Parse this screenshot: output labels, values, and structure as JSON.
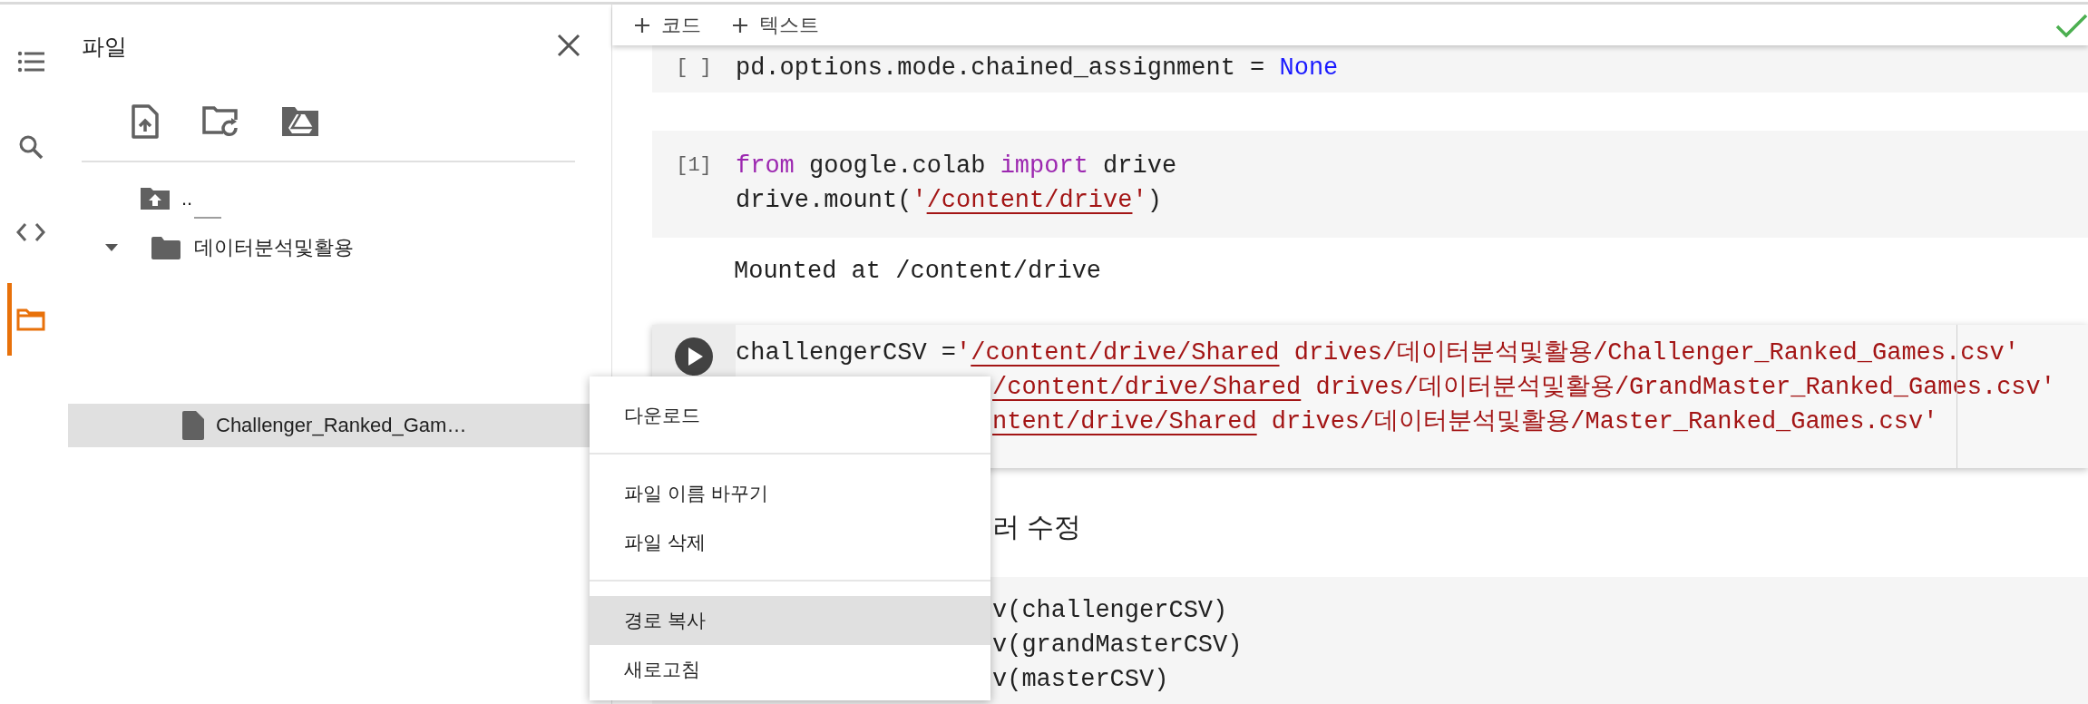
{
  "sidebar": {
    "items": [
      {
        "kind": "toc",
        "selected": false
      },
      {
        "kind": "search",
        "selected": false
      },
      {
        "kind": "code",
        "selected": false
      },
      {
        "kind": "files",
        "selected": true
      }
    ]
  },
  "files_panel": {
    "title": "파일",
    "tree": [
      {
        "kind": "parent",
        "label": "..",
        "selected": false
      },
      {
        "kind": "folder",
        "label": "데이터분석및활용",
        "expanded": true,
        "selected": false,
        "children": [
          {
            "kind": "file",
            "label": "Challenger_Ranked_Gam…",
            "selected": true
          }
        ]
      }
    ]
  },
  "toolbar": {
    "buttons": [
      {
        "label": "코드"
      },
      {
        "label": "텍스트"
      }
    ]
  },
  "cells": [
    {
      "kind": "code",
      "prompt": "[ ]",
      "focused": false,
      "lines": [
        {
          "covered": false,
          "tokens": [
            {
              "kind": "plain",
              "text": "pd.options.mode.chained_assignment = "
            },
            {
              "kind": "const",
              "text": "None"
            }
          ]
        }
      ]
    },
    {
      "kind": "code",
      "prompt": "[1]",
      "focused": false,
      "lines": [
        {
          "covered": false,
          "tokens": [
            {
              "kind": "kw",
              "text": "from"
            },
            {
              "kind": "plain",
              "text": " google.colab "
            },
            {
              "kind": "kw",
              "text": "import"
            },
            {
              "kind": "plain",
              "text": " drive"
            }
          ]
        },
        {
          "covered": false,
          "tokens": [
            {
              "kind": "plain",
              "text": "drive.mount("
            },
            {
              "kind": "str",
              "text": "'"
            },
            {
              "kind": "path",
              "text": "/content/drive"
            },
            {
              "kind": "str",
              "text": "'"
            },
            {
              "kind": "plain",
              "text": ")"
            }
          ]
        }
      ],
      "output": "Mounted at /content/drive"
    },
    {
      "kind": "code",
      "focused": true,
      "lines": [
        {
          "covered": false,
          "tokens": [
            {
              "kind": "plain",
              "text": "challengerCSV ="
            },
            {
              "kind": "str",
              "text": "'"
            },
            {
              "kind": "path",
              "text": "/content/drive/Shared"
            },
            {
              "kind": "str",
              "text": " drives/데이터분석및활용/Challenger_Ranked_Games.csv'"
            }
          ]
        },
        {
          "covered": true,
          "tokens": [
            {
              "kind": "path",
              "text": "/content/drive/Shared"
            },
            {
              "kind": "str",
              "text": " drives/데이터분석및활용/GrandMaster_Ranked_Games.csv'"
            }
          ]
        },
        {
          "covered": true,
          "tokens": [
            {
              "kind": "path",
              "text": "ntent/drive/Shared"
            },
            {
              "kind": "str",
              "text": " drives/데이터분석및활용/Master_Ranked_Games.csv'"
            }
          ]
        }
      ]
    },
    {
      "kind": "text",
      "heading": "러 수정",
      "covered": true
    },
    {
      "kind": "code",
      "focused": false,
      "lines": [
        {
          "covered": true,
          "tokens": [
            {
              "kind": "plain",
              "text": "v(challengerCSV)"
            }
          ]
        },
        {
          "covered": true,
          "tokens": [
            {
              "kind": "plain",
              "text": "v(grandMasterCSV)"
            }
          ]
        },
        {
          "covered": true,
          "tokens": [
            {
              "kind": "plain",
              "text": "v(masterCSV)"
            }
          ]
        }
      ]
    }
  ],
  "context_menu": {
    "groups": [
      [
        {
          "label": "다운로드",
          "selected": false
        }
      ],
      [
        {
          "label": "파일 이름 바꾸기",
          "selected": false
        },
        {
          "label": "파일 삭제",
          "selected": false
        }
      ],
      [
        {
          "label": "경로 복사",
          "selected": true
        },
        {
          "label": "새로고침",
          "selected": false
        }
      ]
    ]
  }
}
